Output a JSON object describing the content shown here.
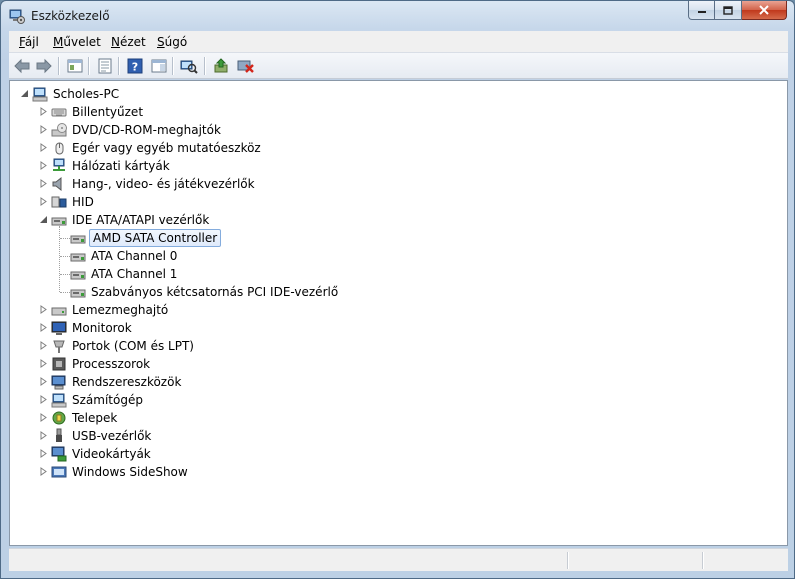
{
  "window": {
    "title": "Eszközkezelő"
  },
  "menu": [
    {
      "label": "Fájl",
      "accel": "F",
      "rest": "ájl"
    },
    {
      "label": "Művelet",
      "accel": "M",
      "rest": "űvelet"
    },
    {
      "label": "Nézet",
      "accel": "N",
      "rest": "ézet"
    },
    {
      "label": "Súgó",
      "accel": "S",
      "rest": "úgó"
    }
  ],
  "tree": {
    "root": "Scholes-PC",
    "categories": [
      {
        "label": "Billentyűzet",
        "icon": "keyboard-icon"
      },
      {
        "label": "DVD/CD-ROM-meghajtók",
        "icon": "optical-drive-icon"
      },
      {
        "label": "Egér vagy egyéb mutatóeszköz",
        "icon": "mouse-icon"
      },
      {
        "label": "Hálózati kártyák",
        "icon": "network-adapter-icon"
      },
      {
        "label": "Hang-, video- és játékvezérlők",
        "icon": "speaker-icon"
      },
      {
        "label": "HID",
        "icon": "hid-icon"
      },
      {
        "label": "IDE ATA/ATAPI vezérlők",
        "icon": "ide-controller-icon",
        "expanded": true,
        "children": [
          "AMD SATA Controller",
          "ATA Channel 0",
          "ATA Channel 1",
          "Szabványos kétcsatornás PCI IDE-vezérlő"
        ]
      },
      {
        "label": "Lemezmeghajtó",
        "icon": "disk-drive-icon"
      },
      {
        "label": "Monitorok",
        "icon": "monitor-icon"
      },
      {
        "label": "Portok (COM és LPT)",
        "icon": "port-icon"
      },
      {
        "label": "Processzorok",
        "icon": "processor-icon"
      },
      {
        "label": "Rendszereszközök",
        "icon": "system-devices-icon"
      },
      {
        "label": "Számítógép",
        "icon": "computer-icon"
      },
      {
        "label": "Telepek",
        "icon": "battery-icon"
      },
      {
        "label": "USB-vezérlők",
        "icon": "usb-icon"
      },
      {
        "label": "Videokártyák",
        "icon": "display-adapter-icon"
      },
      {
        "label": "Windows SideShow",
        "icon": "sideshow-icon"
      }
    ],
    "selected": "AMD SATA Controller"
  }
}
